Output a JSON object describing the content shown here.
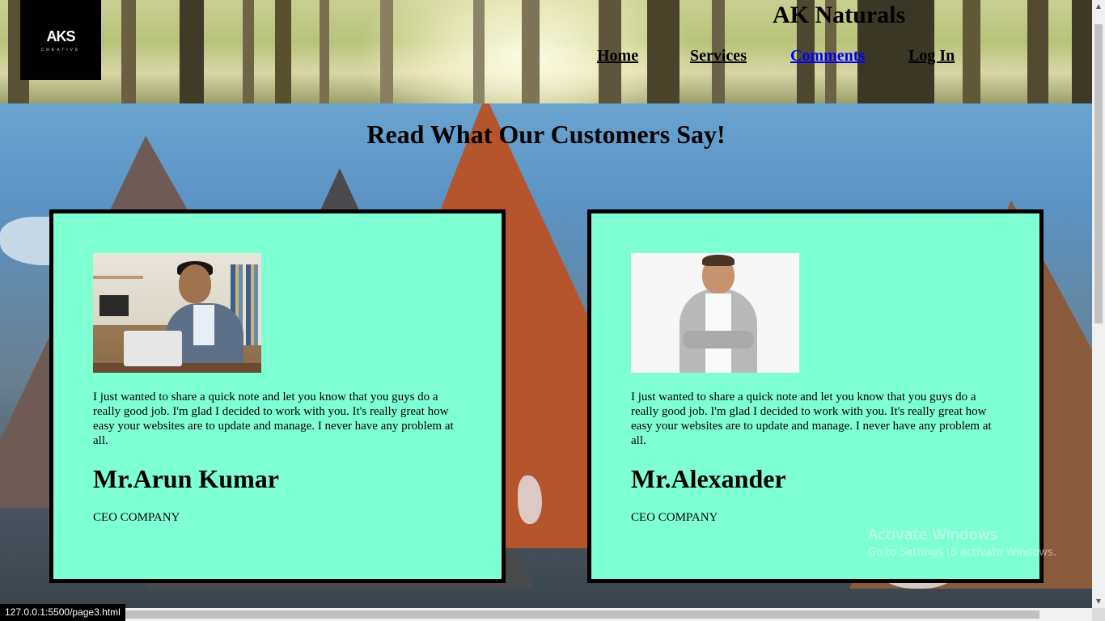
{
  "header": {
    "logo_text": "AKS",
    "logo_subtext": "CREATIVE",
    "site_title": "AK Naturals",
    "nav": [
      {
        "label": "Home",
        "active": false
      },
      {
        "label": "Services",
        "active": false
      },
      {
        "label": "Comments",
        "active": true
      },
      {
        "label": "Log In",
        "active": false
      }
    ]
  },
  "main": {
    "heading": "Read What Our Customers Say!",
    "testimonials": [
      {
        "quote": "I just wanted to share a quick note and let you know that you guys do a really good job. I'm glad I decided to work with you. It's really great how easy your websites are to update and manage. I never have any problem at all.",
        "name": "Mr.Arun Kumar",
        "role": "CEO COMPANY"
      },
      {
        "quote": "I just wanted to share a quick note and let you know that you guys do a really good job. I'm glad I decided to work with you. It's really great how easy your websites are to update and manage. I never have any problem at all.",
        "name": "Mr.Alexander",
        "role": "CEO COMPANY"
      }
    ]
  },
  "watermark": {
    "title": "Activate Windows",
    "subtitle": "Go to Settings to activate Windows."
  },
  "statusbar": {
    "url": "127.0.0.1:5500/page3.html"
  },
  "colors": {
    "card_background": "#7fffd4",
    "card_border": "#000000",
    "active_link": "#0000ee"
  },
  "icons": {
    "scroll_up": "scroll-up-arrow-icon",
    "scroll_down": "scroll-down-arrow-icon"
  }
}
